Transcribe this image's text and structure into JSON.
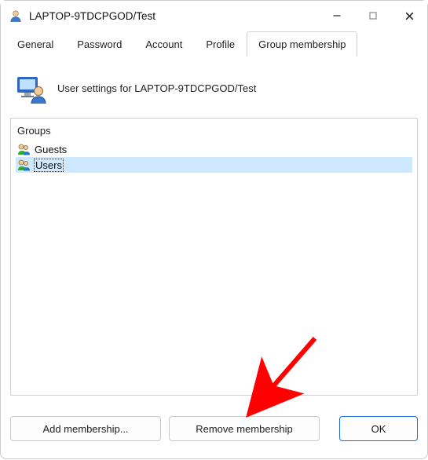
{
  "window": {
    "title": "LAPTOP-9TDCPGOD/Test"
  },
  "tabs": {
    "items": [
      {
        "label": "General"
      },
      {
        "label": "Password"
      },
      {
        "label": "Account"
      },
      {
        "label": "Profile"
      },
      {
        "label": "Group membership"
      }
    ],
    "active_index": 4
  },
  "hero": {
    "text": "User settings for LAPTOP-9TDCPGOD/Test"
  },
  "groups": {
    "heading": "Groups",
    "items": [
      {
        "name": "Guests",
        "selected": false
      },
      {
        "name": "Users",
        "selected": true
      }
    ]
  },
  "buttons": {
    "add": "Add membership...",
    "remove": "Remove membership",
    "ok": "OK"
  },
  "annotation": {
    "arrow_color": "#ff0000"
  }
}
